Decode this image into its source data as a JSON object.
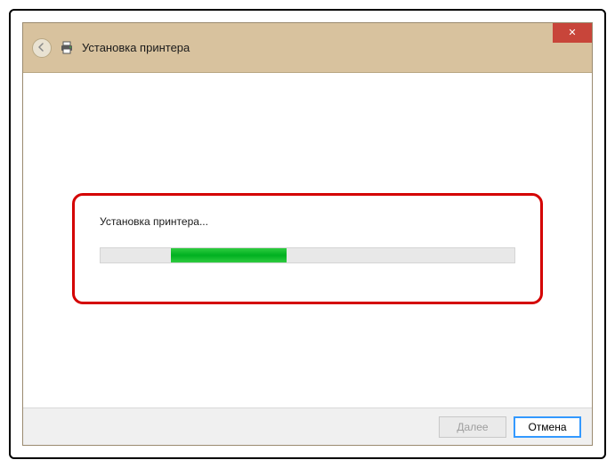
{
  "window": {
    "title": "Установка принтера"
  },
  "content": {
    "status": "Установка принтера...",
    "progress": {
      "indeterminate_left_pct": 17,
      "indeterminate_width_pct": 28
    }
  },
  "footer": {
    "next": "Далее",
    "cancel": "Отмена"
  }
}
